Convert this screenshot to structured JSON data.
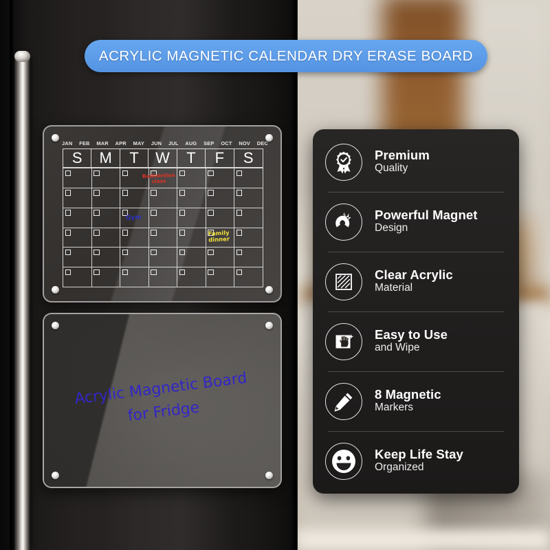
{
  "banner": {
    "title": "ACRYLIC MAGNETIC CALENDAR DRY ERASE BOARD",
    "color": "#5e9de9"
  },
  "calendar_board": {
    "months": [
      "JAN",
      "FEB",
      "MAR",
      "APR",
      "MAY",
      "JUN",
      "JUL",
      "AUG",
      "SEP",
      "OCT",
      "NOV",
      "DEC"
    ],
    "days_of_week": [
      "S",
      "M",
      "T",
      "W",
      "T",
      "F",
      "S"
    ],
    "week_rows": 6,
    "notes": [
      {
        "id": "badmintion-class",
        "line1": "Badmintion",
        "line2": "class",
        "color": "#e03224"
      },
      {
        "id": "gym",
        "line1": "Gym",
        "line2": "",
        "color": "#2a2fc4"
      },
      {
        "id": "family-dinner",
        "line1": "Family",
        "line2": "dinner",
        "color": "#f0e13c"
      }
    ]
  },
  "message_board": {
    "line1": "Acrylic Magnetic Board",
    "line2": "for Fridge",
    "ink_color": "#3226c8"
  },
  "features": [
    {
      "icon": "award-badge-icon",
      "title": "Premium",
      "subtitle": "Quality"
    },
    {
      "icon": "magnet-icon",
      "title": "Powerful Magnet",
      "subtitle": "Design"
    },
    {
      "icon": "acrylic-sheet-icon",
      "title": "Clear Acrylic",
      "subtitle": "Material"
    },
    {
      "icon": "wiping-hand-icon",
      "title": "Easy to Use",
      "subtitle": "and Wipe"
    },
    {
      "icon": "pen-icon",
      "title": "8 Magnetic",
      "subtitle": "Markers"
    },
    {
      "icon": "smiley-face-icon",
      "title": "Keep Life Stay",
      "subtitle": "Organized"
    }
  ]
}
